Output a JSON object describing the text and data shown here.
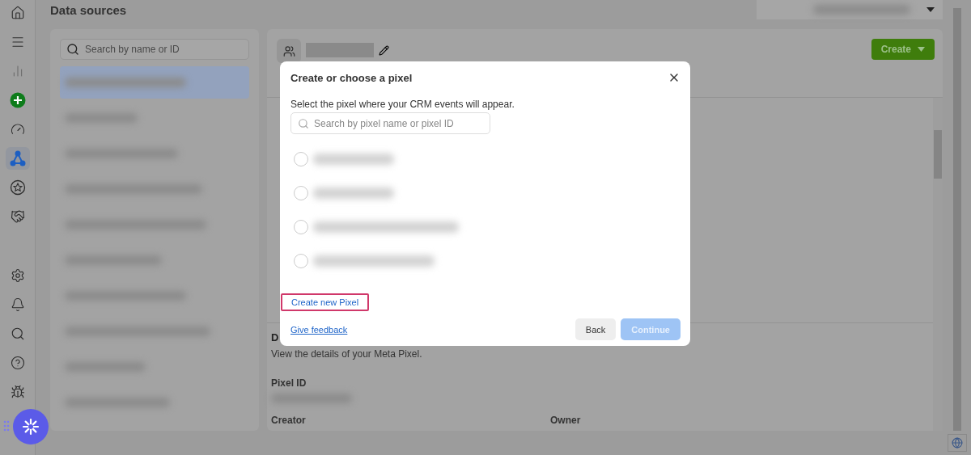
{
  "nav_rail": {
    "top_items": [
      {
        "kind": "home",
        "selected": false
      },
      {
        "kind": "menu",
        "selected": false
      },
      {
        "kind": "chart",
        "selected": false
      },
      {
        "kind": "add",
        "selected": false
      },
      {
        "kind": "gauge",
        "selected": false
      },
      {
        "kind": "network",
        "selected": true
      },
      {
        "kind": "star",
        "selected": false
      },
      {
        "kind": "handshake",
        "selected": false
      }
    ],
    "bottom_items": [
      {
        "kind": "settings"
      },
      {
        "kind": "bell"
      },
      {
        "kind": "search"
      },
      {
        "kind": "help"
      },
      {
        "kind": "bug"
      }
    ]
  },
  "page_title": "Data sources",
  "sources_panel": {
    "search": {
      "placeholder": "Search by name or ID"
    },
    "items": [
      {
        "selected": true
      },
      {
        "selected": false
      },
      {
        "selected": false
      },
      {
        "selected": false
      },
      {
        "selected": false
      },
      {
        "selected": false
      },
      {
        "selected": false
      },
      {
        "selected": false
      },
      {
        "selected": false
      },
      {
        "selected": false
      }
    ]
  },
  "main_panel": {
    "create_button": "Create",
    "details": {
      "heading": "D",
      "description": "View the details of your Meta Pixel.",
      "pixel_id_label": "Pixel ID",
      "creator_label": "Creator",
      "owner_label": "Owner"
    }
  },
  "dialog": {
    "title": "Create or choose a pixel",
    "instruction": "Select the pixel where your CRM events will appear.",
    "search": {
      "placeholder": "Search by pixel name or pixel ID"
    },
    "options": [
      {
        "selected": false
      },
      {
        "selected": false
      },
      {
        "selected": false
      },
      {
        "selected": false
      }
    ],
    "create_link": {
      "label": "Create new Pixel",
      "highlighted": true
    },
    "feedback_link": "Give feedback",
    "back_button": {
      "label": "Back",
      "disabled": false
    },
    "continue_button": {
      "label": "Continue",
      "disabled": true
    }
  }
}
